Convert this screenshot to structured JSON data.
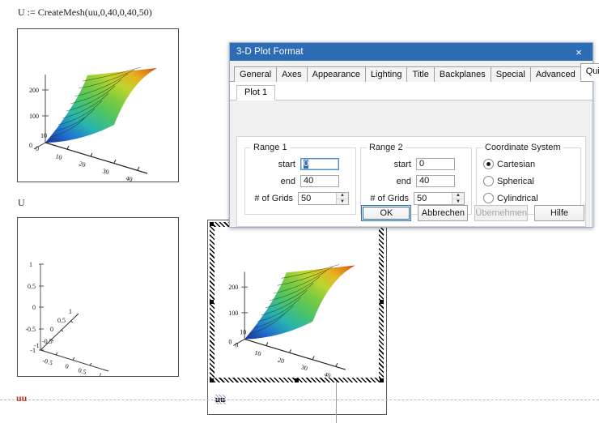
{
  "worksheet": {
    "expression_1": "U := CreateMesh(uu,0,40,0,40,50)",
    "expression_2": "U",
    "red_label": "uu",
    "selected_plot_label": "uu"
  },
  "plots": [
    {
      "name": "surface-plot-top",
      "z_ticks": [
        "200",
        "100"
      ],
      "origin_ticks": [
        "10",
        "0",
        "0"
      ],
      "x_ticks": [
        "10",
        "20",
        "30",
        "40"
      ],
      "type": "3d-surface",
      "colors": [
        "#1b2f93",
        "#1f6fd0",
        "#28b4b0",
        "#57c65a",
        "#9bd23c",
        "#d9d52e",
        "#e8941f",
        "#d4301a"
      ]
    },
    {
      "name": "empty-axes-plot",
      "z_ticks": [
        "1",
        "0.5",
        "0",
        "-0.5",
        "-1"
      ],
      "y_ticks": [
        "1",
        "0.5",
        "0",
        "-0.5"
      ],
      "x_ticks": [
        "-0.5",
        "0",
        "0.5",
        "1"
      ],
      "type": "3d-empty-axes"
    },
    {
      "name": "surface-plot-selected",
      "z_ticks": [
        "200",
        "100"
      ],
      "origin_ticks": [
        "10",
        "0",
        "0"
      ],
      "x_ticks": [
        "10",
        "20",
        "30",
        "40"
      ],
      "type": "3d-surface",
      "selected": true
    }
  ],
  "dialog": {
    "title": "3-D Plot Format",
    "close_label": "×",
    "tabs": [
      {
        "label": "General",
        "active": false
      },
      {
        "label": "Axes",
        "active": false
      },
      {
        "label": "Appearance",
        "active": false
      },
      {
        "label": "Lighting",
        "active": false
      },
      {
        "label": "Title",
        "active": false
      },
      {
        "label": "Backplanes",
        "active": false
      },
      {
        "label": "Special",
        "active": false
      },
      {
        "label": "Advanced",
        "active": false
      },
      {
        "label": "QuickPlot Data",
        "active": true
      }
    ],
    "subtabs": [
      {
        "label": "Plot 1",
        "active": true
      }
    ],
    "range1": {
      "legend": "Range 1",
      "start_label": "start",
      "start_value": "0",
      "end_label": "end",
      "end_value": "40",
      "grids_label": "# of Grids",
      "grids_value": "50"
    },
    "range2": {
      "legend": "Range 2",
      "start_label": "start",
      "start_value": "0",
      "end_label": "end",
      "end_value": "40",
      "grids_label": "# of Grids",
      "grids_value": "50"
    },
    "coordinate_system": {
      "legend": "Coordinate System",
      "options": [
        {
          "label": "Cartesian",
          "selected": true
        },
        {
          "label": "Spherical",
          "selected": false
        },
        {
          "label": "Cylindrical",
          "selected": false
        }
      ]
    },
    "buttons": [
      {
        "label": "OK",
        "state": "default"
      },
      {
        "label": "Abbrechen",
        "state": "normal"
      },
      {
        "label": "Übernehmen",
        "state": "disabled"
      },
      {
        "label": "Hilfe",
        "state": "normal"
      }
    ],
    "spinner_up": "▲",
    "spinner_down": "▼"
  },
  "colors": {
    "title_bar": "#2c6cb5",
    "accent": "#2c6cb5",
    "dialog_bg": "#f0f0f0",
    "red_label": "#c0392b"
  }
}
